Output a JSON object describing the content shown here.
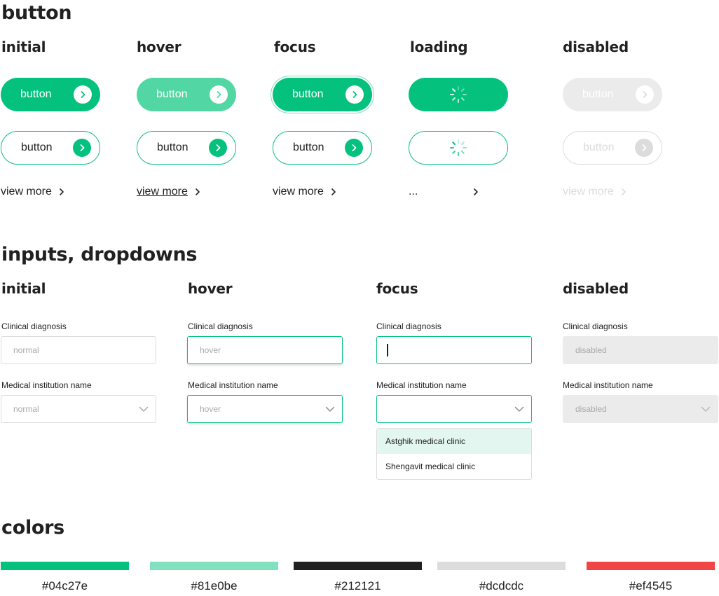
{
  "sections": {
    "button": "button",
    "inputs": "inputs, dropdowns",
    "colors": "colors"
  },
  "button_states": {
    "initial": "initial",
    "hover": "hover",
    "focus": "focus",
    "loading": "loading",
    "disabled": "disabled"
  },
  "button_label": "button",
  "view_more": "view more",
  "loading_text": "...",
  "input_states": {
    "initial": "initial",
    "hover": "hover",
    "focus": "focus",
    "disabled": "disabled"
  },
  "fields": {
    "clinical_label": "Clinical diagnosis",
    "institution_label": "Medical institution name",
    "values": {
      "initial": "normal",
      "hover": "hover",
      "focus": "",
      "disabled": "disabled"
    }
  },
  "dropdown_options": [
    "Astghik medical clinic",
    "Shengavit medical clinic"
  ],
  "icons": {
    "arrow": "chevron-right-icon",
    "dropdown": "chevron-down-icon",
    "spinner": "spinner-icon"
  },
  "colors": [
    {
      "hex": "#04c27e",
      "label": "#04c27e"
    },
    {
      "hex": "#81e0be",
      "label": "#81e0be"
    },
    {
      "hex": "#212121",
      "label": "#212121"
    },
    {
      "hex": "#dcdcdc",
      "label": "#dcdcdc"
    },
    {
      "hex": "#ef4545",
      "label": "#ef4545"
    }
  ]
}
